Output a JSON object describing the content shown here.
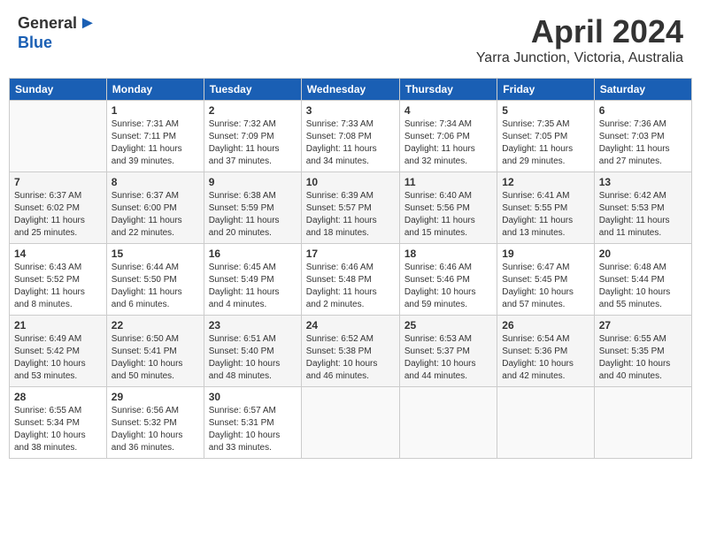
{
  "header": {
    "logo_general": "General",
    "logo_blue": "Blue",
    "month": "April 2024",
    "location": "Yarra Junction, Victoria, Australia"
  },
  "days_of_week": [
    "Sunday",
    "Monday",
    "Tuesday",
    "Wednesday",
    "Thursday",
    "Friday",
    "Saturday"
  ],
  "weeks": [
    [
      {
        "day": "",
        "info": ""
      },
      {
        "day": "1",
        "info": "Sunrise: 7:31 AM\nSunset: 7:11 PM\nDaylight: 11 hours\nand 39 minutes."
      },
      {
        "day": "2",
        "info": "Sunrise: 7:32 AM\nSunset: 7:09 PM\nDaylight: 11 hours\nand 37 minutes."
      },
      {
        "day": "3",
        "info": "Sunrise: 7:33 AM\nSunset: 7:08 PM\nDaylight: 11 hours\nand 34 minutes."
      },
      {
        "day": "4",
        "info": "Sunrise: 7:34 AM\nSunset: 7:06 PM\nDaylight: 11 hours\nand 32 minutes."
      },
      {
        "day": "5",
        "info": "Sunrise: 7:35 AM\nSunset: 7:05 PM\nDaylight: 11 hours\nand 29 minutes."
      },
      {
        "day": "6",
        "info": "Sunrise: 7:36 AM\nSunset: 7:03 PM\nDaylight: 11 hours\nand 27 minutes."
      }
    ],
    [
      {
        "day": "7",
        "info": "Sunrise: 6:37 AM\nSunset: 6:02 PM\nDaylight: 11 hours\nand 25 minutes."
      },
      {
        "day": "8",
        "info": "Sunrise: 6:37 AM\nSunset: 6:00 PM\nDaylight: 11 hours\nand 22 minutes."
      },
      {
        "day": "9",
        "info": "Sunrise: 6:38 AM\nSunset: 5:59 PM\nDaylight: 11 hours\nand 20 minutes."
      },
      {
        "day": "10",
        "info": "Sunrise: 6:39 AM\nSunset: 5:57 PM\nDaylight: 11 hours\nand 18 minutes."
      },
      {
        "day": "11",
        "info": "Sunrise: 6:40 AM\nSunset: 5:56 PM\nDaylight: 11 hours\nand 15 minutes."
      },
      {
        "day": "12",
        "info": "Sunrise: 6:41 AM\nSunset: 5:55 PM\nDaylight: 11 hours\nand 13 minutes."
      },
      {
        "day": "13",
        "info": "Sunrise: 6:42 AM\nSunset: 5:53 PM\nDaylight: 11 hours\nand 11 minutes."
      }
    ],
    [
      {
        "day": "14",
        "info": "Sunrise: 6:43 AM\nSunset: 5:52 PM\nDaylight: 11 hours\nand 8 minutes."
      },
      {
        "day": "15",
        "info": "Sunrise: 6:44 AM\nSunset: 5:50 PM\nDaylight: 11 hours\nand 6 minutes."
      },
      {
        "day": "16",
        "info": "Sunrise: 6:45 AM\nSunset: 5:49 PM\nDaylight: 11 hours\nand 4 minutes."
      },
      {
        "day": "17",
        "info": "Sunrise: 6:46 AM\nSunset: 5:48 PM\nDaylight: 11 hours\nand 2 minutes."
      },
      {
        "day": "18",
        "info": "Sunrise: 6:46 AM\nSunset: 5:46 PM\nDaylight: 10 hours\nand 59 minutes."
      },
      {
        "day": "19",
        "info": "Sunrise: 6:47 AM\nSunset: 5:45 PM\nDaylight: 10 hours\nand 57 minutes."
      },
      {
        "day": "20",
        "info": "Sunrise: 6:48 AM\nSunset: 5:44 PM\nDaylight: 10 hours\nand 55 minutes."
      }
    ],
    [
      {
        "day": "21",
        "info": "Sunrise: 6:49 AM\nSunset: 5:42 PM\nDaylight: 10 hours\nand 53 minutes."
      },
      {
        "day": "22",
        "info": "Sunrise: 6:50 AM\nSunset: 5:41 PM\nDaylight: 10 hours\nand 50 minutes."
      },
      {
        "day": "23",
        "info": "Sunrise: 6:51 AM\nSunset: 5:40 PM\nDaylight: 10 hours\nand 48 minutes."
      },
      {
        "day": "24",
        "info": "Sunrise: 6:52 AM\nSunset: 5:38 PM\nDaylight: 10 hours\nand 46 minutes."
      },
      {
        "day": "25",
        "info": "Sunrise: 6:53 AM\nSunset: 5:37 PM\nDaylight: 10 hours\nand 44 minutes."
      },
      {
        "day": "26",
        "info": "Sunrise: 6:54 AM\nSunset: 5:36 PM\nDaylight: 10 hours\nand 42 minutes."
      },
      {
        "day": "27",
        "info": "Sunrise: 6:55 AM\nSunset: 5:35 PM\nDaylight: 10 hours\nand 40 minutes."
      }
    ],
    [
      {
        "day": "28",
        "info": "Sunrise: 6:55 AM\nSunset: 5:34 PM\nDaylight: 10 hours\nand 38 minutes."
      },
      {
        "day": "29",
        "info": "Sunrise: 6:56 AM\nSunset: 5:32 PM\nDaylight: 10 hours\nand 36 minutes."
      },
      {
        "day": "30",
        "info": "Sunrise: 6:57 AM\nSunset: 5:31 PM\nDaylight: 10 hours\nand 33 minutes."
      },
      {
        "day": "",
        "info": ""
      },
      {
        "day": "",
        "info": ""
      },
      {
        "day": "",
        "info": ""
      },
      {
        "day": "",
        "info": ""
      }
    ]
  ]
}
